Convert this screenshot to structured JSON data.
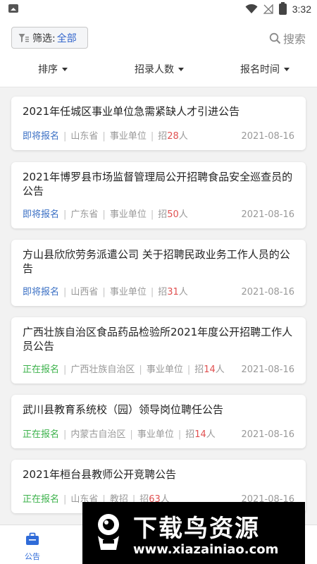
{
  "status_bar": {
    "time": "3:32",
    "icons": [
      "photo-icon",
      "wifi-icon",
      "no-signal-icon",
      "battery-icon"
    ]
  },
  "top_bar": {
    "filter_label": "筛选:",
    "filter_value": "全部",
    "search_label": "搜索"
  },
  "sort_bar": {
    "items": [
      "排序",
      "招录人数",
      "报名时间"
    ]
  },
  "announcements": [
    {
      "title": "2021年任城区事业单位急需紧缺人才引进公告",
      "status": "即将报名",
      "province": "山东省",
      "category": "事业单位",
      "recruit_prefix": "招",
      "recruit_count": "28",
      "recruit_unit": "人",
      "date": "2021-08-16"
    },
    {
      "title": "2021年博罗县市场监督管理局公开招聘食品安全巡查员的公告",
      "status": "即将报名",
      "province": "广东省",
      "category": "事业单位",
      "recruit_prefix": "招",
      "recruit_count": "50",
      "recruit_unit": "人",
      "date": "2021-08-16"
    },
    {
      "title": "方山县欣欣劳务派遣公司 关于招聘民政业务工作人员的公告",
      "status": "即将报名",
      "province": "山西省",
      "category": "事业单位",
      "recruit_prefix": "招",
      "recruit_count": "31",
      "recruit_unit": "人",
      "date": "2021-08-16"
    },
    {
      "title": "广西壮族自治区食品药品检验所2021年度公开招聘工作人员公告",
      "status": "正在报名",
      "province": "广西壮族自治区",
      "category": "事业单位",
      "recruit_prefix": "招",
      "recruit_count": "14",
      "recruit_unit": "人",
      "date": "2021-08-16"
    },
    {
      "title": "武川县教育系统校（园）领导岗位聘任公告",
      "status": "正在报名",
      "province": "内蒙古自治区",
      "category": "事业单位",
      "recruit_prefix": "招",
      "recruit_count": "14",
      "recruit_unit": "人",
      "date": "2021-08-16"
    },
    {
      "title": "2021年桓台县教师公开竞聘公告",
      "status": "正在报名",
      "province": "山东省",
      "category": "教招",
      "recruit_prefix": "招",
      "recruit_count": "63",
      "recruit_unit": "人",
      "date": "2021-08-16"
    }
  ],
  "tab_bar": {
    "announcement_label": "公告"
  },
  "watermark": {
    "title": "下载鸟资源",
    "url": "www.xiazainiao.com"
  },
  "colors": {
    "accent_blue": "#3366cc",
    "status_soon": "#3a6fc4",
    "status_open": "#3cb24b",
    "count_red": "#e05050"
  }
}
